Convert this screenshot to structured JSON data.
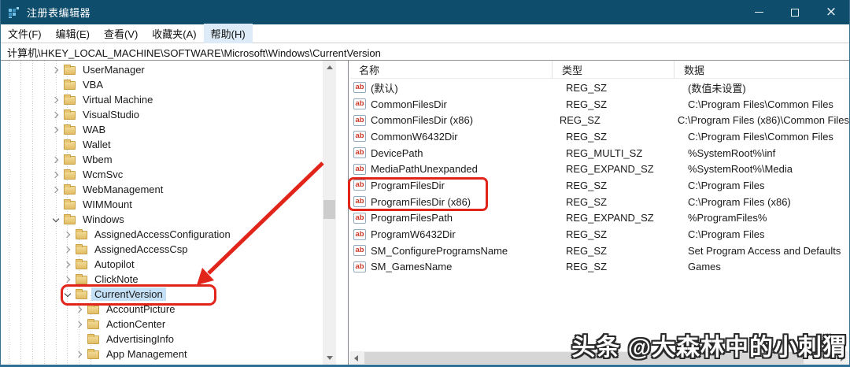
{
  "window": {
    "title": "注册表编辑器"
  },
  "menu": {
    "items": [
      {
        "label": "文件(F)",
        "highlighted": false
      },
      {
        "label": "编辑(E)",
        "highlighted": false
      },
      {
        "label": "查看(V)",
        "highlighted": false
      },
      {
        "label": "收藏夹(A)",
        "highlighted": false
      },
      {
        "label": "帮助(H)",
        "highlighted": true
      }
    ]
  },
  "address": {
    "path": "计算机\\HKEY_LOCAL_MACHINE\\SOFTWARE\\Microsoft\\Windows\\CurrentVersion"
  },
  "tree": {
    "items": [
      {
        "label": "UserManager",
        "level": 0,
        "expander": "right",
        "selected": false
      },
      {
        "label": "VBA",
        "level": 0,
        "expander": "none",
        "selected": false
      },
      {
        "label": "Virtual Machine",
        "level": 0,
        "expander": "right",
        "selected": false
      },
      {
        "label": "VisualStudio",
        "level": 0,
        "expander": "right",
        "selected": false
      },
      {
        "label": "WAB",
        "level": 0,
        "expander": "right",
        "selected": false
      },
      {
        "label": "Wallet",
        "level": 0,
        "expander": "none",
        "selected": false
      },
      {
        "label": "Wbem",
        "level": 0,
        "expander": "right",
        "selected": false
      },
      {
        "label": "WcmSvc",
        "level": 0,
        "expander": "right",
        "selected": false
      },
      {
        "label": "WebManagement",
        "level": 0,
        "expander": "right",
        "selected": false
      },
      {
        "label": "WIMMount",
        "level": 0,
        "expander": "none",
        "selected": false
      },
      {
        "label": "Windows",
        "level": 0,
        "expander": "down",
        "selected": false
      },
      {
        "label": "AssignedAccessConfiguration",
        "level": 1,
        "expander": "right",
        "selected": false
      },
      {
        "label": "AssignedAccessCsp",
        "level": 1,
        "expander": "right",
        "selected": false
      },
      {
        "label": "Autopilot",
        "level": 1,
        "expander": "right",
        "selected": false
      },
      {
        "label": "ClickNote",
        "level": 1,
        "expander": "right",
        "selected": false
      },
      {
        "label": "CurrentVersion",
        "level": 1,
        "expander": "down",
        "selected": true
      },
      {
        "label": "AccountPicture",
        "level": 2,
        "expander": "right",
        "selected": false
      },
      {
        "label": "ActionCenter",
        "level": 2,
        "expander": "right",
        "selected": false
      },
      {
        "label": "AdvertisingInfo",
        "level": 2,
        "expander": "none",
        "selected": false
      },
      {
        "label": "App Management",
        "level": 2,
        "expander": "right",
        "selected": false
      }
    ]
  },
  "list": {
    "columns": {
      "name": "名称",
      "type": "类型",
      "data": "数据"
    },
    "rows": [
      {
        "name": "(默认)",
        "type": "REG_SZ",
        "data": "(数值未设置)"
      },
      {
        "name": "CommonFilesDir",
        "type": "REG_SZ",
        "data": "C:\\Program Files\\Common Files"
      },
      {
        "name": "CommonFilesDir (x86)",
        "type": "REG_SZ",
        "data": "C:\\Program Files (x86)\\Common Files"
      },
      {
        "name": "CommonW6432Dir",
        "type": "REG_SZ",
        "data": "C:\\Program Files\\Common Files"
      },
      {
        "name": "DevicePath",
        "type": "REG_MULTI_SZ",
        "data": "%SystemRoot%\\inf"
      },
      {
        "name": "MediaPathUnexpanded",
        "type": "REG_EXPAND_SZ",
        "data": "%SystemRoot%\\Media"
      },
      {
        "name": "ProgramFilesDir",
        "type": "REG_SZ",
        "data": "C:\\Program Files"
      },
      {
        "name": "ProgramFilesDir (x86)",
        "type": "REG_SZ",
        "data": "C:\\Program Files (x86)"
      },
      {
        "name": "ProgramFilesPath",
        "type": "REG_EXPAND_SZ",
        "data": "%ProgramFiles%"
      },
      {
        "name": "ProgramW6432Dir",
        "type": "REG_SZ",
        "data": "C:\\Program Files"
      },
      {
        "name": "SM_ConfigureProgramsName",
        "type": "REG_SZ",
        "data": "Set Program Access and Defaults"
      },
      {
        "name": "SM_GamesName",
        "type": "REG_SZ",
        "data": "Games"
      }
    ],
    "value_icon": "ab"
  },
  "watermark": {
    "text": "头条 @大森林中的小刺猬"
  },
  "colors": {
    "titlebar": "#0e4d6c",
    "annotation_red": "#e1251b",
    "selection": "#c4e0f6",
    "window_border": "#2e6f96"
  }
}
